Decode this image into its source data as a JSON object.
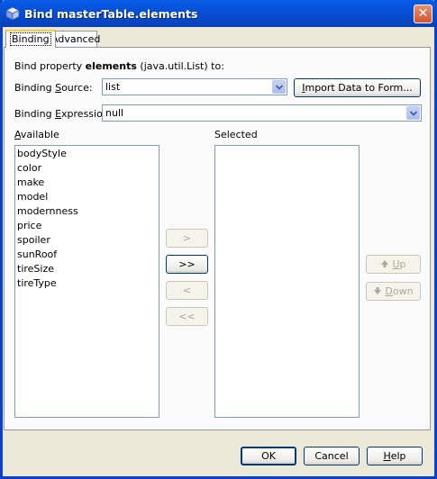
{
  "window": {
    "title": "Bind masterTable.elements",
    "close_label": "✕"
  },
  "tabs": [
    {
      "label": "Binding",
      "selected": true
    },
    {
      "label": "Advanced",
      "selected": false
    }
  ],
  "binding": {
    "property_prefix": "Bind property ",
    "property_name": "elements",
    "property_suffix": " (java.util.List) to:",
    "source_label_pre": "Binding ",
    "source_label_ul": "S",
    "source_label_post": "ource:",
    "source_value": "list",
    "import_button_pre": "",
    "import_button_ul": "I",
    "import_button_post": "mport Data to Form...",
    "expression_label_pre": "Binding ",
    "expression_label_ul": "E",
    "expression_label_post": "xpression:",
    "expression_value": "null"
  },
  "available": {
    "label_ul": "A",
    "label_rest": "vailable",
    "items": [
      "bodyStyle",
      "color",
      "make",
      "model",
      "modernness",
      "price",
      "spoiler",
      "sunRoof",
      "tireSize",
      "tireType"
    ]
  },
  "selected": {
    "label": "Selected",
    "items": []
  },
  "transfer_buttons": {
    "add": ">",
    "add_all": ">>",
    "remove": "<",
    "remove_all": "<<"
  },
  "order_buttons": {
    "up_ul": "U",
    "up_rest": "p",
    "down_ul": "D",
    "down_rest": "own"
  },
  "footer": {
    "ok": "OK",
    "cancel": "Cancel",
    "help_ul": "H",
    "help_rest": "elp"
  }
}
